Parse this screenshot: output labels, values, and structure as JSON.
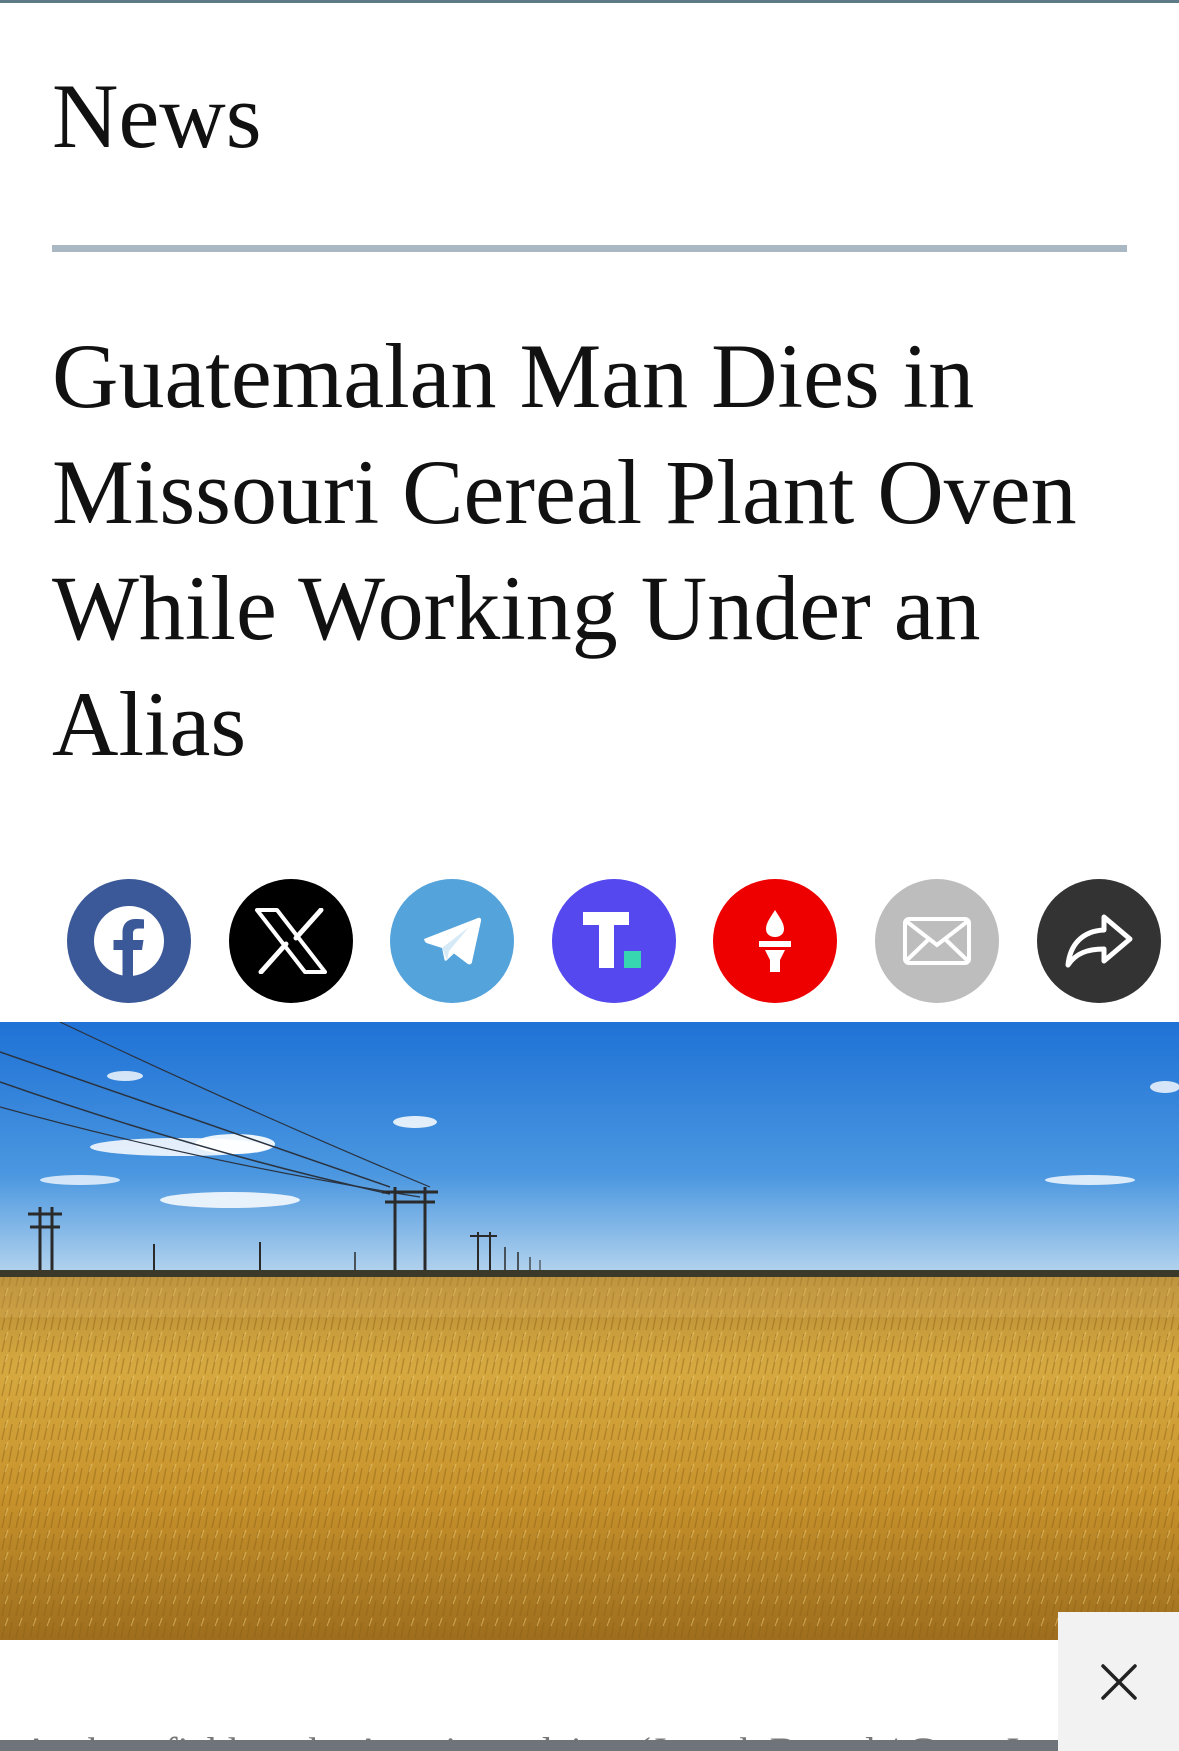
{
  "section": {
    "label": "News"
  },
  "article": {
    "headline": "Guatemalan Man Dies in Missouri Cereal Plant Oven While Working Under an Alias",
    "caption": "A wheat field on the American plains. (Joseph Bernal / Getty Images)"
  },
  "share": {
    "buttons": [
      {
        "name": "facebook",
        "icon": "facebook-icon",
        "color": "#3b5998"
      },
      {
        "name": "x",
        "icon": "x-icon",
        "color": "#000000"
      },
      {
        "name": "telegram",
        "icon": "telegram-icon",
        "color": "#54a3db"
      },
      {
        "name": "truth-social",
        "icon": "truth-social-icon",
        "color": "#5448ee"
      },
      {
        "name": "gettr",
        "icon": "gettr-torch-icon",
        "color": "#ee0000"
      },
      {
        "name": "email",
        "icon": "envelope-icon",
        "color": "#bdbdbd"
      },
      {
        "name": "more-share",
        "icon": "share-arrow-icon",
        "color": "#333333"
      }
    ]
  },
  "close": {
    "icon": "close-icon"
  },
  "colors": {
    "top_rule": "#5e7a86",
    "divider": "#a9b8c2",
    "sky": "#3a86d8",
    "wheat": "#c99a30"
  }
}
